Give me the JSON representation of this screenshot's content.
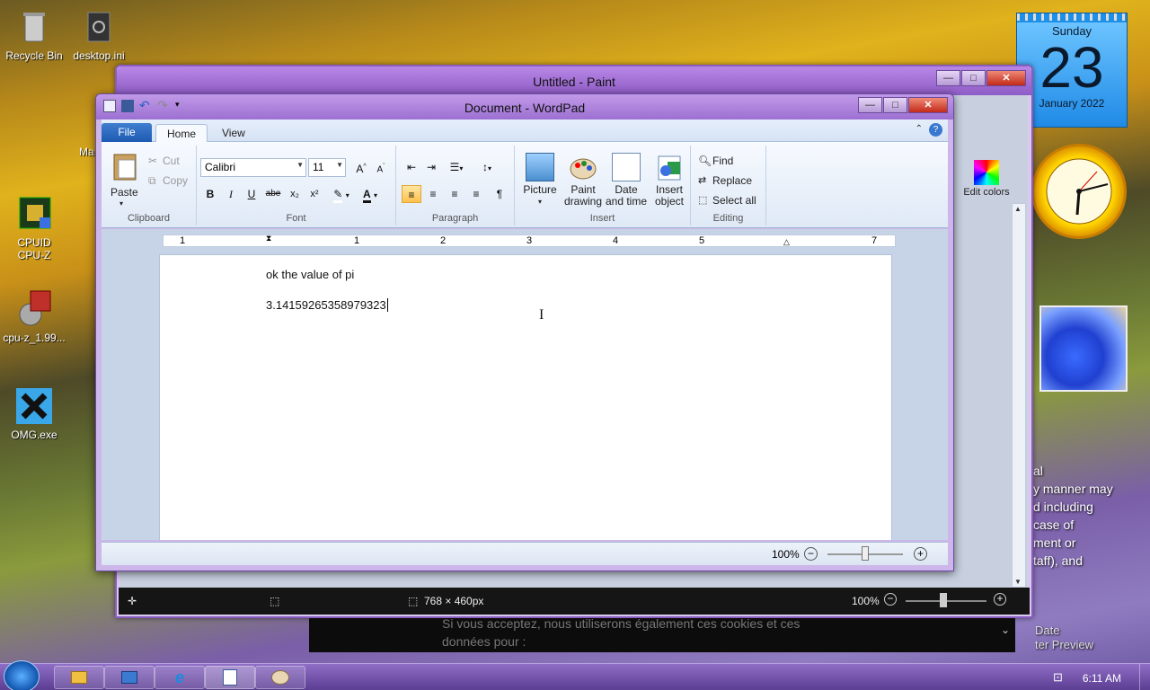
{
  "desktop": {
    "icons": [
      {
        "label": "Recycle Bin"
      },
      {
        "label": "desktop.ini"
      },
      {
        "label": "CPUID CPU-Z"
      },
      {
        "label": "cpu-z_1.99..."
      },
      {
        "label": "OMG.exe"
      }
    ],
    "left_clip": "Ma"
  },
  "gadgets": {
    "calendar": {
      "weekday": "Sunday",
      "day": "23",
      "month": "January 2022"
    }
  },
  "background_text": {
    "lines": [
      "al",
      "y manner may",
      "d including",
      "case of",
      "ment or",
      "taff), and"
    ]
  },
  "paint": {
    "title": "Untitled - Paint",
    "ribbon_edit_colors": "Edit colors",
    "status": {
      "dimensions": "768 × 460px",
      "zoom": "100%"
    }
  },
  "wordpad": {
    "title": "Document - WordPad",
    "tabs": {
      "file": "File",
      "home": "Home",
      "view": "View"
    },
    "clipboard": {
      "paste": "Paste",
      "cut": "Cut",
      "copy": "Copy",
      "label": "Clipboard"
    },
    "font": {
      "family": "Calibri",
      "size": "11",
      "label": "Font",
      "bold": "B",
      "italic": "I",
      "underline": "U",
      "strike": "abe"
    },
    "paragraph": {
      "label": "Paragraph"
    },
    "insert": {
      "picture": "Picture",
      "paint_drawing": "Paint drawing",
      "date_time": "Date and time",
      "insert_object": "Insert object",
      "label": "Insert"
    },
    "editing": {
      "find": "Find",
      "replace": "Replace",
      "select_all": "Select all",
      "label": "Editing"
    },
    "ruler": [
      "1",
      "1",
      "2",
      "3",
      "4",
      "5",
      "7"
    ],
    "document": {
      "line1": "ok the value of pi",
      "line2": "3.14159265358979323"
    },
    "status": {
      "zoom": "100%"
    }
  },
  "banner": {
    "line1": "Si vous acceptez, nous utiliserons également ces cookies et ces",
    "line2": "données pour :"
  },
  "right_clip": {
    "line1": "Date",
    "line2": "ter Preview"
  },
  "taskbar": {
    "time": "6:11 AM"
  }
}
